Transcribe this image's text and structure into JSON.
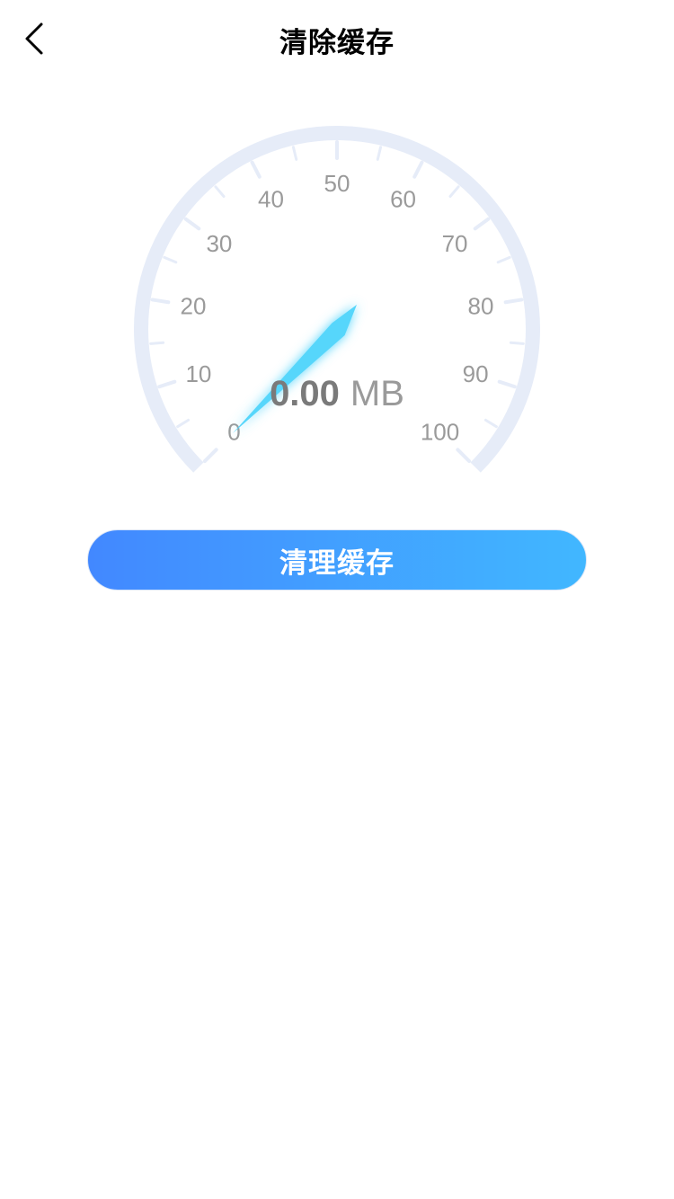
{
  "nav": {
    "title": "清除缓存",
    "back_icon": "chevron-left-icon"
  },
  "gauge": {
    "value": "0.00",
    "unit": "MB",
    "range": [
      0,
      100
    ],
    "current": 0,
    "tick_labels": [
      "0",
      "10",
      "20",
      "30",
      "40",
      "50",
      "60",
      "70",
      "80",
      "90",
      "100"
    ],
    "track_color": "#e6ecf8",
    "needle_color": "#56d6fb",
    "label_color": "#9a9a9a",
    "value_color": "#7a7a7a"
  },
  "action": {
    "clean_label": "清理缓存",
    "gradient_start": "#4288ff",
    "gradient_end": "#41b7ff"
  }
}
